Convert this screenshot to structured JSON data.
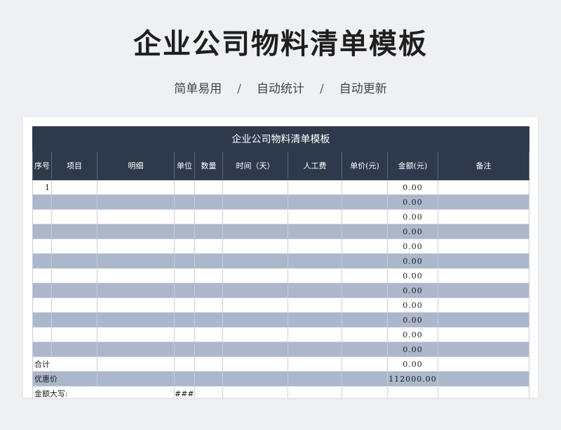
{
  "page": {
    "title": "企业公司物料清单模板",
    "subtitle_items": [
      "简单易用",
      "自动统计",
      "自动更新"
    ],
    "separator": "/"
  },
  "colors": {
    "header_bg": "#2e3a4b",
    "alt_row_bg": "#acb7cb",
    "page_bg": "#eef0f3"
  },
  "sheet": {
    "title": "企业公司物料清单模板",
    "columns": [
      "序号",
      "项目",
      "明细",
      "单位",
      "数量",
      "时间（天）",
      "人工费",
      "单价(元)",
      "金额(元)",
      "备注"
    ],
    "rows": [
      {
        "no": "1",
        "amount": "0.00"
      },
      {
        "no": "",
        "amount": "0.00"
      },
      {
        "no": "",
        "amount": "0.00"
      },
      {
        "no": "",
        "amount": "0.00"
      },
      {
        "no": "",
        "amount": "0.00"
      },
      {
        "no": "",
        "amount": "0.00"
      },
      {
        "no": "",
        "amount": "0.00"
      },
      {
        "no": "",
        "amount": "0.00"
      },
      {
        "no": "",
        "amount": "0.00"
      },
      {
        "no": "",
        "amount": "0.00"
      },
      {
        "no": "",
        "amount": "0.00"
      },
      {
        "no": "",
        "amount": "0.00"
      }
    ],
    "total_label": "合计",
    "total_amount": "0.00",
    "discount_label": "优惠价",
    "discount_amount": "112000.00",
    "capital_label": "金额大写:",
    "capital_value": "###"
  }
}
